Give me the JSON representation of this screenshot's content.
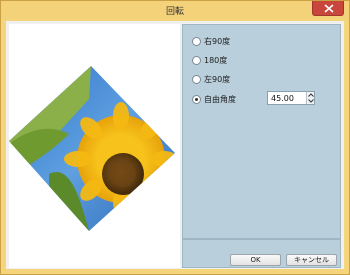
{
  "window": {
    "title": "回転"
  },
  "rotation_options": [
    {
      "label": "右90度",
      "checked": false
    },
    {
      "label": "180度",
      "checked": false
    },
    {
      "label": "左90度",
      "checked": false
    },
    {
      "label": "自由角度",
      "checked": true
    }
  ],
  "angle": {
    "value": "45.00"
  },
  "buttons": {
    "ok": "OK",
    "cancel": "キャンセル"
  },
  "icons": {
    "close": "close-icon",
    "spin_up": "chevron-up-icon",
    "spin_down": "chevron-down-icon"
  },
  "colors": {
    "title_bar": "#f3d27a",
    "close_button": "#c8463c",
    "options_panel": "#b9cfdc"
  }
}
